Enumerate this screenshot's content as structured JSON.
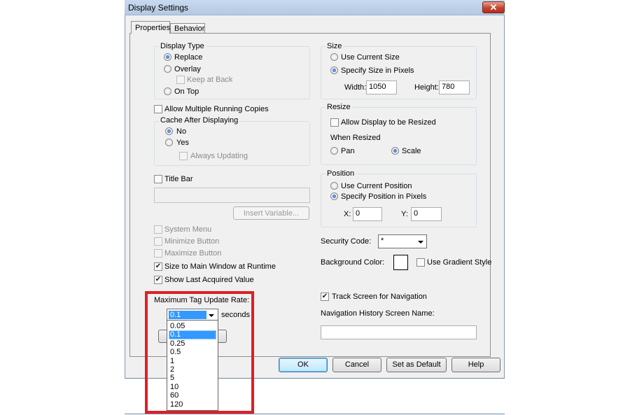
{
  "window": {
    "title": "Display Settings",
    "close_glyph": "✕"
  },
  "tabs": [
    {
      "label": "Properties",
      "active": true
    },
    {
      "label": "Behavior",
      "active": false
    }
  ],
  "display_type": {
    "legend": "Display Type",
    "options": [
      "Replace",
      "Overlay",
      "On Top"
    ],
    "selected": "Replace",
    "keep_at_back": "Keep at Back"
  },
  "allow_multiple": "Allow Multiple Running Copies",
  "cache": {
    "legend": "Cache After Displaying",
    "options": [
      "No",
      "Yes"
    ],
    "selected": "No",
    "always_updating": "Always Updating"
  },
  "title_bar": {
    "label": "Title Bar",
    "value": "",
    "insert_variable": "Insert Variable..."
  },
  "window_options": {
    "system_menu": "System Menu",
    "minimize_button": "Minimize Button",
    "maximize_button": "Maximize Button",
    "size_to_main": "Size to Main Window at Runtime",
    "show_last": "Show Last Acquired Value"
  },
  "max_tag_rate": {
    "label": "Maximum Tag Update Rate:",
    "value": "0.1",
    "unit": "seconds",
    "options": [
      "0.05",
      "0.1",
      "0.25",
      "0.5",
      "1",
      "2",
      "5",
      "10",
      "60",
      "120"
    ],
    "selected_index": 1
  },
  "size": {
    "legend": "Size",
    "use_current": "Use Current Size",
    "specify": "Specify Size in Pixels",
    "selected": "Specify Size in Pixels",
    "width_label": "Width:",
    "width_value": "1050",
    "height_label": "Height:",
    "height_value": "780"
  },
  "resize": {
    "legend": "Resize",
    "allow": "Allow Display to be Resized",
    "when_resized": "When Resized",
    "pan": "Pan",
    "scale": "Scale",
    "selected": "Scale"
  },
  "position": {
    "legend": "Position",
    "use_current": "Use Current Position",
    "specify": "Specify Position in Pixels",
    "selected": "Specify Position in Pixels",
    "x_label": "X:",
    "x_value": "0",
    "y_label": "Y:",
    "y_value": "0"
  },
  "security": {
    "label": "Security Code:",
    "value": "*"
  },
  "background": {
    "label": "Background Color:",
    "color": "#ffffff",
    "gradient": "Use Gradient Style"
  },
  "track_screen": "Track Screen for Navigation",
  "nav_history": {
    "label": "Navigation History Screen Name:",
    "value": ""
  },
  "buttons": {
    "ok": "OK",
    "cancel": "Cancel",
    "set_default": "Set as Default",
    "help": "Help"
  },
  "highlight_color": "#e01e26"
}
